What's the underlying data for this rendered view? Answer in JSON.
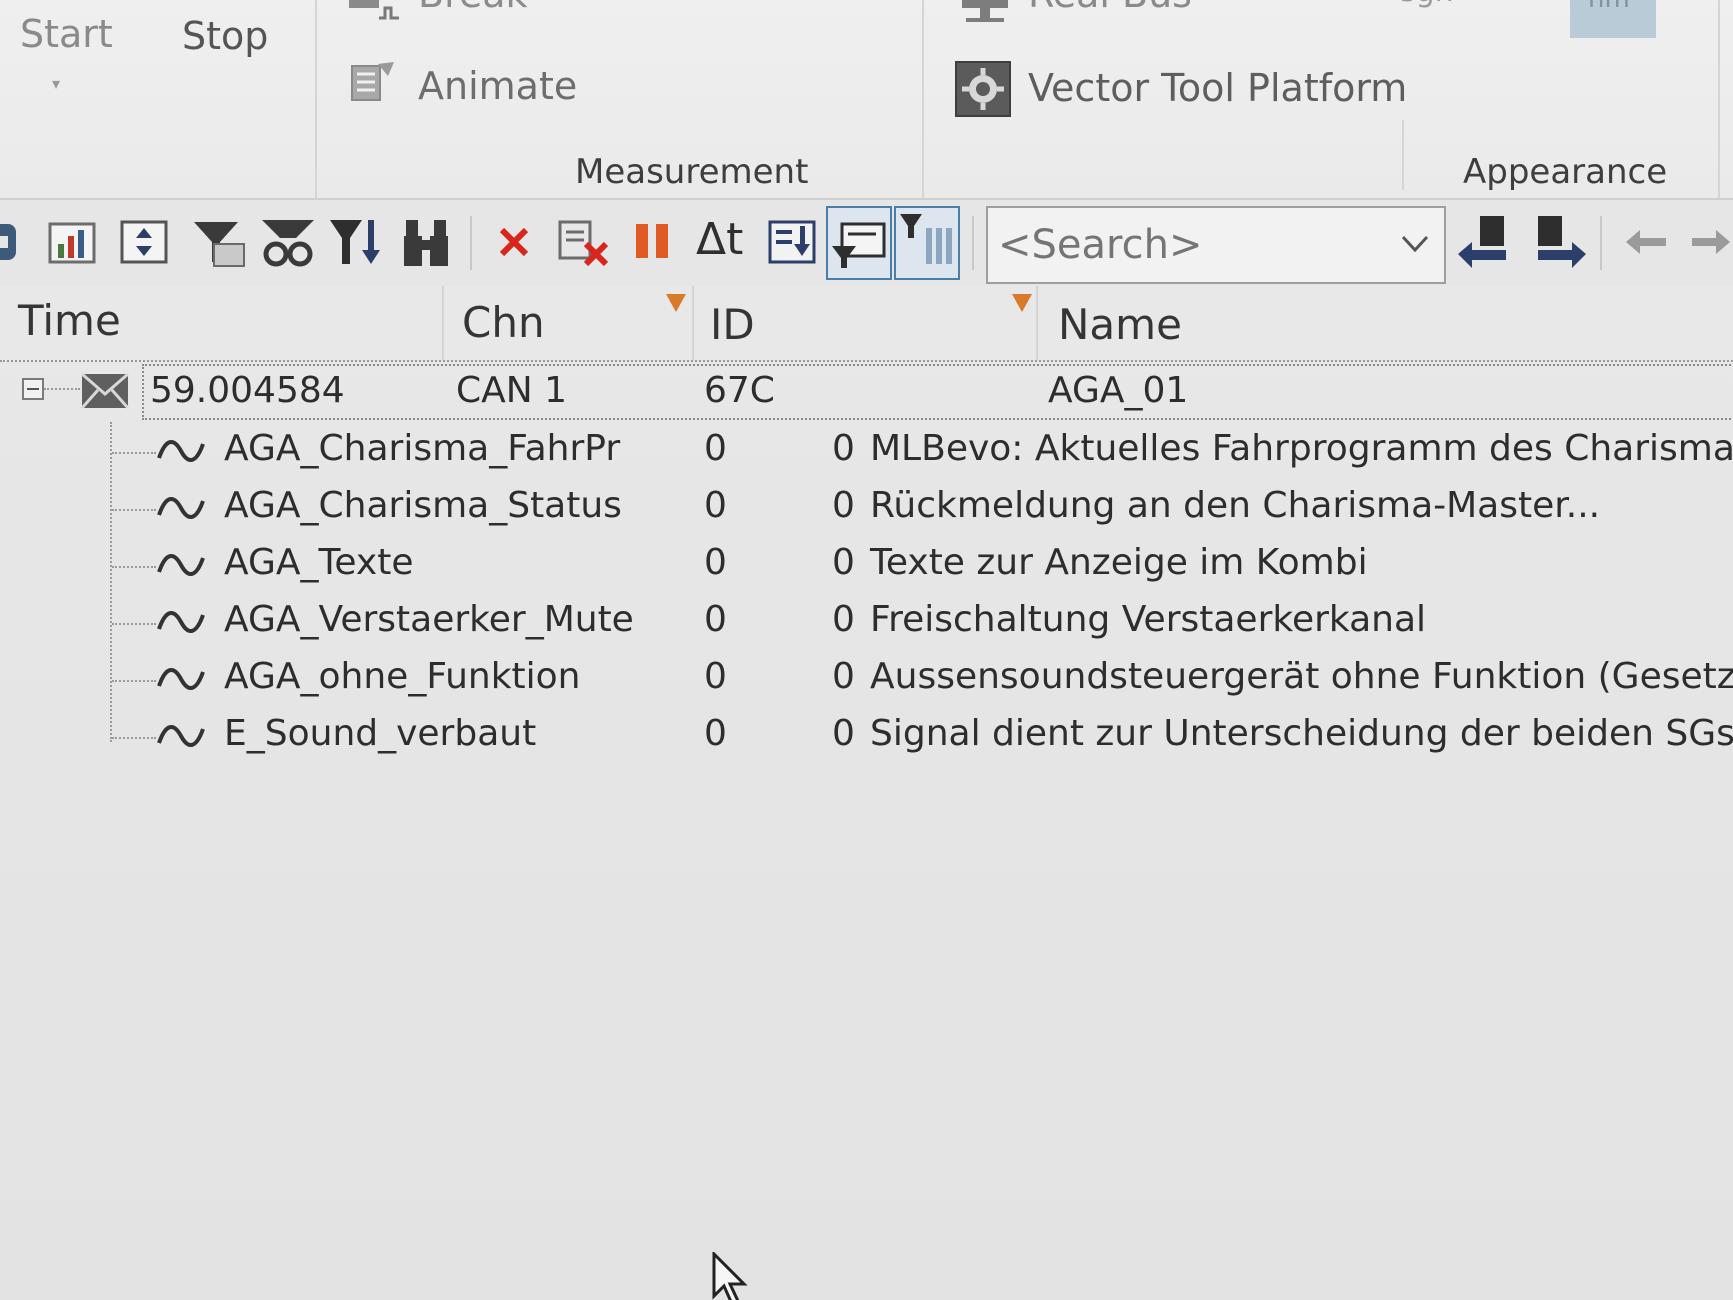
{
  "ribbon": {
    "start_label": "Start",
    "stop_label": "Stop",
    "break_label": "Break",
    "animate_label": "Animate",
    "real_bus_label": "Real Bus",
    "vector_tool_platform_label": "Vector Tool Platform",
    "right_partial_text": "sgn",
    "highlight_partial_text": "hm",
    "groups": {
      "measurement": "Measurement",
      "appearance": "Appearance"
    }
  },
  "toolbar": {
    "search_placeholder": "<Search>",
    "icons": [
      "db-icon",
      "chart-icon",
      "scroll-icon",
      "print-filter-icon",
      "binoculars-icon",
      "filter-sort-icon",
      "find-icon",
      "delete-icon",
      "clear-icon",
      "pause-icon",
      "delta-time-icon",
      "autoscroll-icon",
      "filter-view-icon",
      "column-filter-icon",
      "find-prev-icon",
      "find-next-icon",
      "back-icon",
      "forward-icon"
    ],
    "delta_label": "Δt",
    "delete_color": "#d9261c",
    "pause_color": "#e05a24"
  },
  "grid": {
    "columns": [
      "Time",
      "Chn",
      "ID",
      "Name"
    ],
    "message": {
      "time": "59.004584",
      "chn": "CAN 1",
      "id": "67C",
      "name": "AGA_01"
    },
    "signals": [
      {
        "name": "AGA_Charisma_FahrPr",
        "raw": "0",
        "phys": "0",
        "description": "MLBevo: Aktuelles Fahrprogramm des Charisma-Tei"
      },
      {
        "name": "AGA_Charisma_Status",
        "raw": "0",
        "phys": "0",
        "description": "Rückmeldung an den Charisma-Master..."
      },
      {
        "name": "AGA_Texte",
        "raw": "0",
        "phys": "0",
        "description": "Texte zur Anzeige im Kombi"
      },
      {
        "name": "AGA_Verstaerker_Mute",
        "raw": "0",
        "phys": "0",
        "description": "Freischaltung Verstaerkerkanal"
      },
      {
        "name": "AGA_ohne_Funktion",
        "raw": "0",
        "phys": "0",
        "description": "Aussensoundsteuergerät ohne Funktion (Gesetzliche"
      },
      {
        "name": "E_Sound_verbaut",
        "raw": "0",
        "phys": "0",
        "description": "Signal dient zur Unterscheidung der beiden SGs 'akti"
      }
    ],
    "filter_icon_color": "#d9792a"
  }
}
